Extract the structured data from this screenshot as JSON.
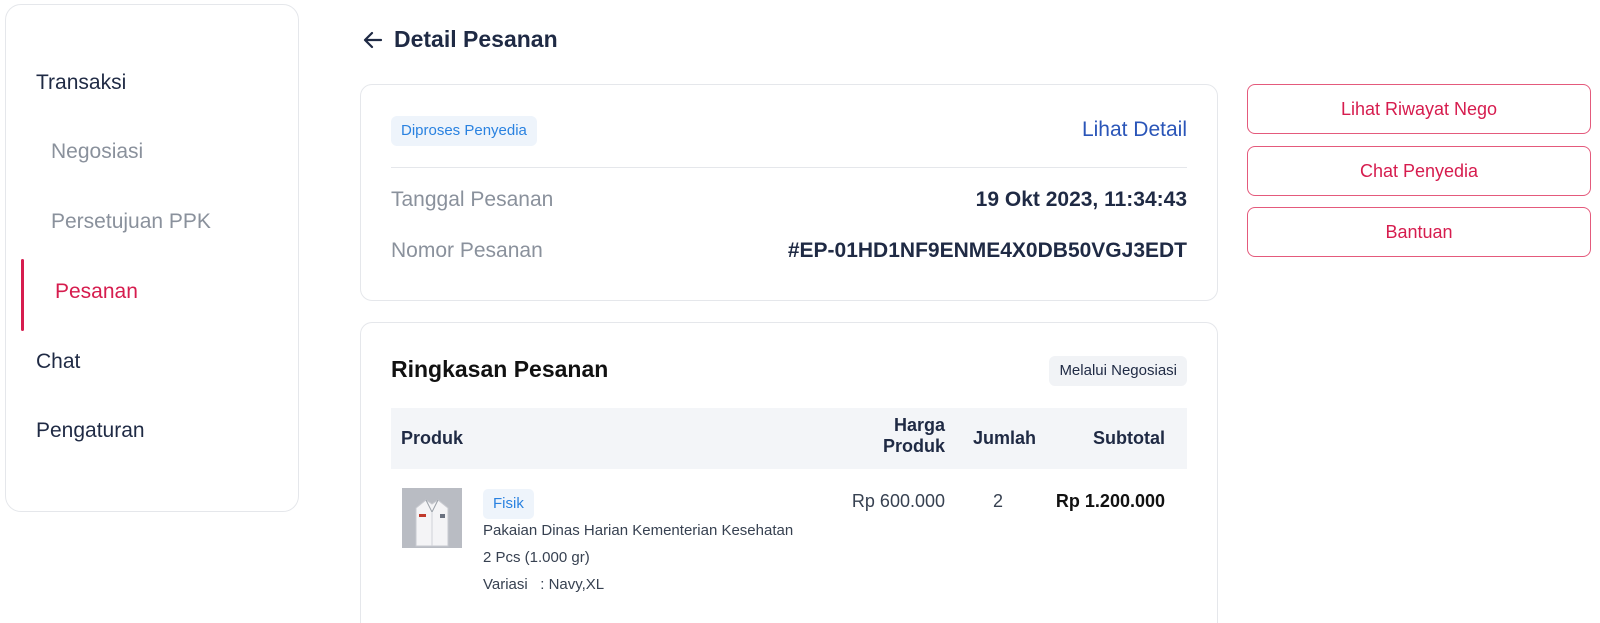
{
  "sidebar": {
    "items": [
      {
        "label": "Transaksi"
      },
      {
        "label": "Negosiasi"
      },
      {
        "label": "Persetujuan PPK"
      },
      {
        "label": "Pesanan"
      },
      {
        "label": "Chat"
      },
      {
        "label": "Pengaturan"
      }
    ],
    "active": "Pesanan"
  },
  "header": {
    "title": "Detail Pesanan",
    "back_icon": "arrow-left-icon"
  },
  "order_card": {
    "status": "Diproses Penyedia",
    "detail_link": "Lihat Detail",
    "date_label": "Tanggal Pesanan",
    "date_value": "19 Okt 2023, 11:34:43",
    "number_label": "Nomor Pesanan",
    "number_value": "#EP-01HD1NF9ENME4X0DB50VGJ3EDT"
  },
  "summary": {
    "title": "Ringkasan Pesanan",
    "badge": "Melalui Negosiasi",
    "columns": {
      "product": "Produk",
      "price_line1": "Harga",
      "price_line2": "Produk",
      "qty": "Jumlah",
      "subtotal": "Subtotal"
    },
    "rows": [
      {
        "type": "Fisik",
        "name": "Pakaian Dinas Harian Kementerian Kesehatan",
        "weight": "2 Pcs (1.000 gr)",
        "variant": "Variasi   : Navy,XL",
        "price": "Rp 600.000",
        "qty": "2",
        "subtotal": "Rp 1.200.000"
      }
    ]
  },
  "actions": {
    "history": "Lihat Riwayat Nego",
    "chat": "Chat Penyedia",
    "help": "Bantuan"
  },
  "colors": {
    "accent": "#d61c4e",
    "link": "#2a55b8",
    "badge_text": "#2a82e0",
    "badge_bg": "#eef4fb"
  }
}
